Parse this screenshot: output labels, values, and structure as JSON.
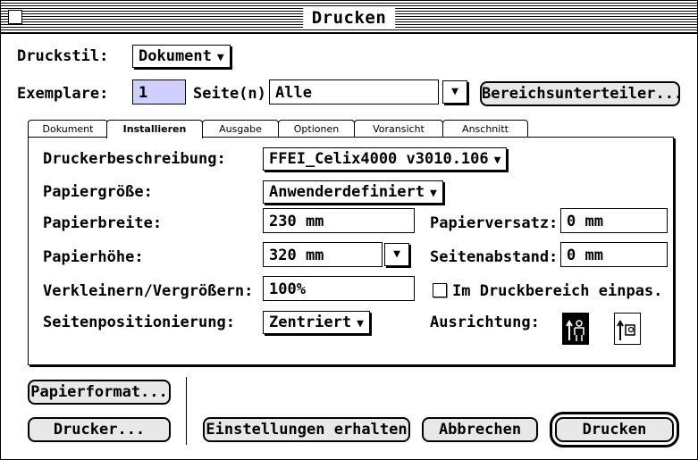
{
  "window": {
    "title": "Drucken"
  },
  "top": {
    "druckstil_label": "Druckstil:",
    "druckstil_value": "Dokument",
    "exemplare_label": "Exemplare:",
    "exemplare_value": "1",
    "seiten_label": "Seite(n):",
    "seiten_value": "Alle",
    "bereich_button": "Bereichsunterteiler..."
  },
  "tabs": [
    "Dokument",
    "Installieren",
    "Ausgabe",
    "Optionen",
    "Voransicht",
    "Anschnitt"
  ],
  "active_tab": "Installieren",
  "panel": {
    "druckerbeschreibung_label": "Druckerbeschreibung:",
    "druckerbeschreibung_value": "FFEI_Celix4000 v3010.106",
    "papiergroesse_label": "Papiergröße:",
    "papiergroesse_value": "Anwenderdefiniert",
    "papierbreite_label": "Papierbreite:",
    "papierbreite_value": "230 mm",
    "papierversatz_label": "Papierversatz:",
    "papierversatz_value": "0 mm",
    "papierhoehe_label": "Papierhöhe:",
    "papierhoehe_value": "320 mm",
    "seitenabstand_label": "Seitenabstand:",
    "seitenabstand_value": "0 mm",
    "verkleinern_label": "Verkleinern/Vergrößern:",
    "verkleinern_value": "100%",
    "einpassen_label": "Im Druckbereich einpas.",
    "einpassen_checked": false,
    "seitenpos_label": "Seitenpositionierung:",
    "seitenpos_value": "Zentriert",
    "ausrichtung_label": "Ausrichtung:",
    "ausrichtung_selected": "portrait"
  },
  "buttons": {
    "papierformat": "Papierformat...",
    "drucker": "Drucker...",
    "einstellungen": "Einstellungen erhalten",
    "abbrechen": "Abbrechen",
    "drucken": "Drucken"
  }
}
